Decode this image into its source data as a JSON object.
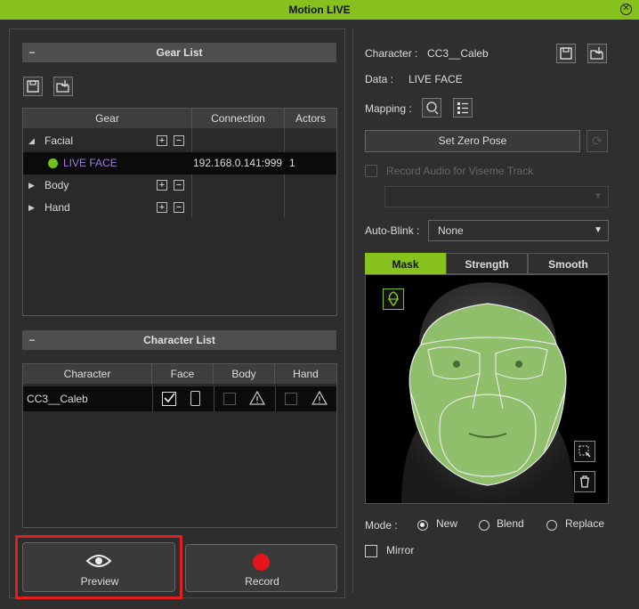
{
  "window": {
    "title": "Motion LIVE",
    "close_icon": "close-icon"
  },
  "gear_list": {
    "header": "Gear List",
    "columns": [
      "Gear",
      "Connection",
      "Actors"
    ],
    "rows": [
      {
        "name": "Facial",
        "connection": "",
        "actors": ""
      },
      {
        "name": "LIVE FACE",
        "connection": "192.168.0.141:999",
        "actors": "1",
        "status_color": "#6fc11d"
      },
      {
        "name": "Body",
        "connection": "",
        "actors": ""
      },
      {
        "name": "Hand",
        "connection": "",
        "actors": ""
      }
    ]
  },
  "character_list": {
    "header": "Character List",
    "columns": [
      "Character",
      "Face",
      "Body",
      "Hand"
    ],
    "rows": [
      {
        "name": "CC3__Caleb",
        "face_checked": true,
        "body_checked": false,
        "hand_checked": false
      }
    ]
  },
  "buttons": {
    "preview": "Preview",
    "record": "Record"
  },
  "right": {
    "character_label": "Character :",
    "character_value": "CC3__Caleb",
    "data_label": "Data :",
    "data_value": "LIVE FACE",
    "mapping_label": "Mapping :",
    "set_zero_pose": "Set Zero Pose",
    "record_audio": "Record Audio for Viseme Track",
    "auto_blink_label": "Auto-Blink :",
    "auto_blink_value": "None",
    "tabs": [
      "Mask",
      "Strength",
      "Smooth"
    ],
    "active_tab": "Mask",
    "mode_label": "Mode :",
    "modes": [
      "New",
      "Blend",
      "Replace"
    ],
    "selected_mode": "New",
    "mirror_label": "Mirror"
  },
  "colors": {
    "accent": "#86c11d",
    "record": "#e8141b",
    "highlight_border": "#e02020",
    "face_mask": "#8fbf6a"
  }
}
